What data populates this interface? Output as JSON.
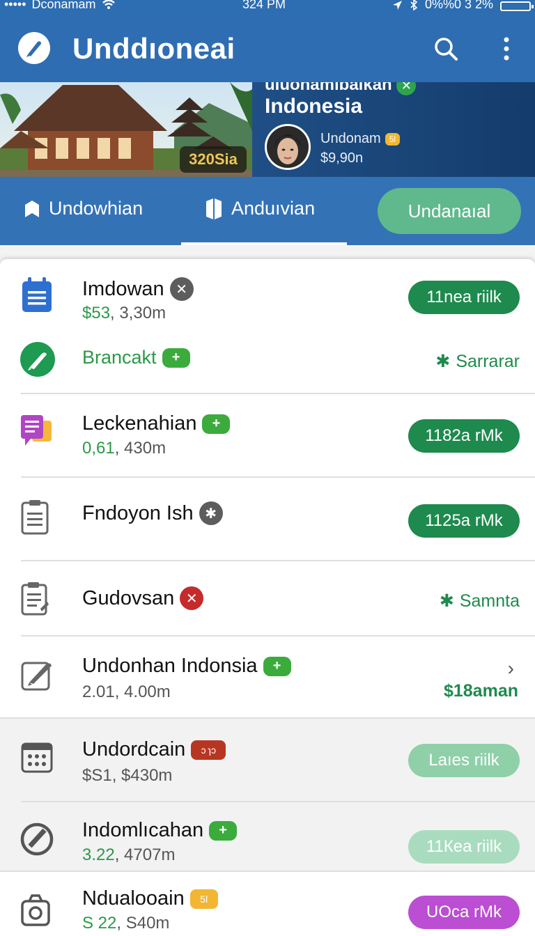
{
  "status": {
    "carrier": "Dconamam",
    "time": "324 PM",
    "battery": "0%%0 3 2%"
  },
  "app": {
    "title": "Unddıoneai"
  },
  "banner": {
    "image_label": "320Sia",
    "subtitle": "uiuonamıbaıkan",
    "title": "Indonesia",
    "profile_name": "Undonam",
    "profile_badge": "5l",
    "profile_amount": "$9,90n"
  },
  "tabs": [
    {
      "label": "Undowhian",
      "icon": "bookmark-icon"
    },
    {
      "label": "Anduıvian",
      "icon": "flag-icon",
      "selected": true
    },
    {
      "label": "Undanaıal",
      "style": "pill"
    }
  ],
  "items": [
    {
      "title": "Imdowan",
      "sub_green": "$53",
      "sub_rest": ", 3,30m",
      "badge": "x",
      "action": "11nea riilk",
      "icon": "calendar-icon"
    },
    {
      "title": "Brancakt",
      "badge": "+",
      "status": "Sarrarar",
      "icon": "pencil-icon"
    },
    {
      "title": "Leckenahian",
      "sub_green": "0,61",
      "sub_rest": ", 430m",
      "badge": "+",
      "action": "1182a rMk",
      "icon": "chat-icon"
    },
    {
      "title": "Fndoyon Ish",
      "badge": "x",
      "action": "1125a rMk",
      "icon": "document-icon"
    },
    {
      "title": "Gudovsan",
      "badge": "x-red",
      "status": "Samnta",
      "icon": "checklist-icon"
    },
    {
      "title": "Undonhan Indonsia",
      "sub": "2.01, 4.00m",
      "badge": "+",
      "amount": "$18aman",
      "icon": "edit-icon"
    },
    {
      "title": "Undordcain",
      "sub": "$S1, $430m",
      "badge_text": "ɔ ɿɔ",
      "action": "Laıes riilk",
      "icon": "calendar-grid-icon"
    },
    {
      "title": "Indomlıcahan",
      "sub_green": "3.22",
      "sub_rest": ", 4707m",
      "badge": "+",
      "action": "11Кea riilk",
      "icon": "blocked-icon"
    },
    {
      "title": "Ndualooain",
      "sub_green": "S 22",
      "sub_rest": ", S40m",
      "badge_text": "5l",
      "action": "UOca rMk",
      "icon": "camera-icon"
    }
  ],
  "colors": {
    "primary": "#2f6db2",
    "accent_green": "#1e8a4e",
    "pill_green": "#5fb98c",
    "purple": "#bb4ed2"
  }
}
